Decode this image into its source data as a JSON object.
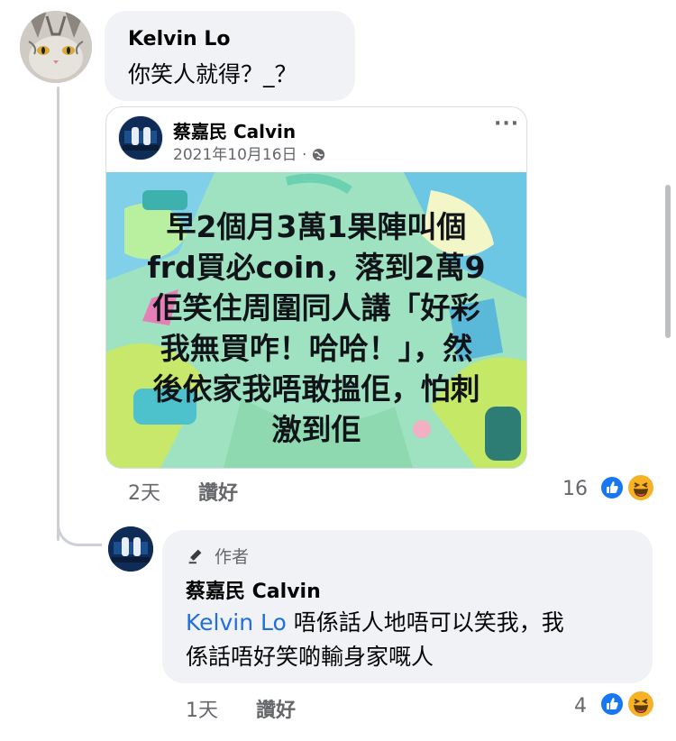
{
  "comment": {
    "author": "Kelvin Lo",
    "text": "你笑人就得？_？",
    "shared_post": {
      "page_name": "蔡嘉民 Calvin",
      "date": "2021年10月16日",
      "separator": "·",
      "privacy_icon": "globe-icon",
      "more_icon": "more-dots-icon",
      "image_text_lines": [
        "早2個月3萬1果陣叫個",
        "frd買必coin，落到2萬9",
        "佢笑住周圍同人講「好彩",
        "我無買咋！哈哈！」，然",
        "後依家我唔敢搵佢，怕刺",
        "激到佢"
      ]
    },
    "time": "2天",
    "like_label": "讚好",
    "reaction_count": "16",
    "reactions": [
      "like-icon",
      "haha-icon"
    ]
  },
  "reply": {
    "badge_label": "作者",
    "badge_icon": "pen-icon",
    "author": "蔡嘉民 Calvin",
    "mention": "Kelvin Lo",
    "text_line1": "唔係話人地唔可以笑我，我",
    "text_line2": "係話唔好笑啲輸身家嘅人",
    "time": "1天",
    "like_label": "讚好",
    "reaction_count": "4",
    "reactions": [
      "like-icon",
      "haha-icon"
    ]
  },
  "colors": {
    "bubble": "#f0f2f5",
    "mention": "#216fdb",
    "meta": "#65676b",
    "like_blue": "#1877f2",
    "haha_yellow": "#f7b125"
  }
}
